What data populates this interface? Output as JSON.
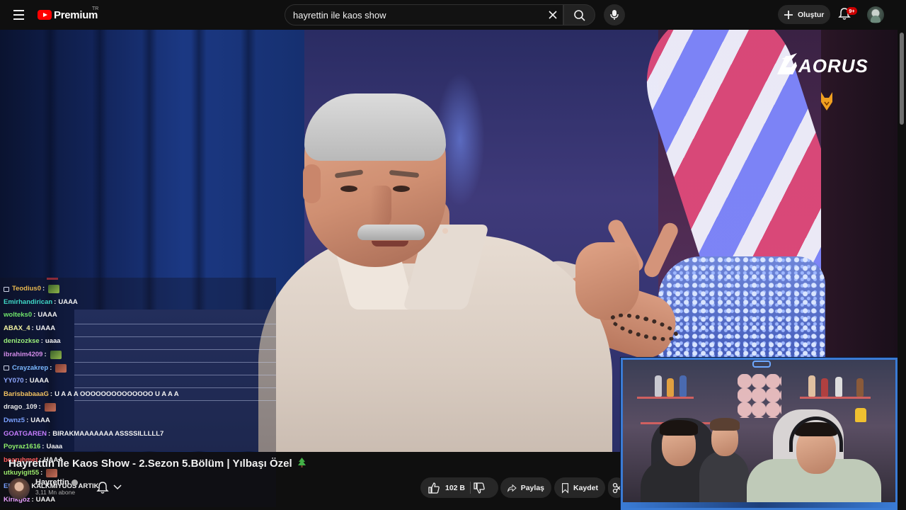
{
  "header": {
    "logo_text": "Premium",
    "country": "TR",
    "search_value": "hayrettin ile kaos show",
    "create_label": "Oluştur",
    "notifications_badge": "9+"
  },
  "watermark": {
    "brand": "AORUS"
  },
  "chat": [
    {
      "user": "Teodius0",
      "msg": "",
      "color": "#e8b84f",
      "badge": true,
      "emote": "green"
    },
    {
      "user": "Emirhandirican",
      "msg": "UAAA",
      "color": "#3fd6c5",
      "badge": false,
      "emote": ""
    },
    {
      "user": "wolteks0",
      "msg": "UAAA",
      "color": "#6fe36a",
      "badge": false,
      "emote": ""
    },
    {
      "user": "ABAX_4",
      "msg": "UAAA",
      "color": "#f1f1a0",
      "badge": false,
      "emote": ""
    },
    {
      "user": "denizozkse",
      "msg": "uaaa",
      "color": "#9cf07a",
      "badge": false,
      "emote": ""
    },
    {
      "user": "ibrahim4209",
      "msg": "",
      "color": "#d28be8",
      "badge": false,
      "emote": "green"
    },
    {
      "user": "Crayzakrep",
      "msg": "",
      "color": "#7ab8ff",
      "badge": true,
      "emote": "red"
    },
    {
      "user": "YY070",
      "msg": "UAAA",
      "color": "#8fa8ff",
      "badge": false,
      "emote": ""
    },
    {
      "user": "BarisbabaaaG",
      "msg": "U A A A OOOOOOOOOOOOOO U A A A",
      "color": "#f0c060",
      "badge": false,
      "emote": ""
    },
    {
      "user": "drago_109",
      "msg": "",
      "color": "#e8e8e8",
      "badge": false,
      "emote": "red"
    },
    {
      "user": "Dwnz5",
      "msg": "UAAA",
      "color": "#7aa0ff",
      "badge": false,
      "emote": ""
    },
    {
      "user": "GOATGAREN",
      "msg": "BIRAKMAAAAAAA ASSSSILLLLL7",
      "color": "#c77dff",
      "badge": false,
      "emote": ""
    },
    {
      "user": "Poyraz1616",
      "msg": "Uaaa",
      "color": "#8fef6a",
      "badge": false,
      "emote": ""
    },
    {
      "user": "bearuhmet",
      "msg": "UAAA",
      "color": "#ff5a5a",
      "badge": false,
      "emote": ""
    },
    {
      "user": "utkuyigit55",
      "msg": "",
      "color": "#9ae86b",
      "badge": false,
      "emote": "red"
    },
    {
      "user": "Eloxen",
      "msg": "KALKMIYUOS ARTIK",
      "color": "#7aa0ff",
      "badge": false,
      "emote": ""
    },
    {
      "user": "Kirikgoz",
      "msg": "UAAA",
      "color": "#e8a0ff",
      "badge": false,
      "emote": ""
    }
  ],
  "video": {
    "title": "Hayrettin ile Kaos Show - 2.Sezon 5.Bölüm | Yılbaşı Özel",
    "channel": "Hayrettin",
    "subscribers": "3,11 Mn abone",
    "likes": "102 B",
    "share_label": "Paylaş",
    "save_label": "Kaydet"
  }
}
